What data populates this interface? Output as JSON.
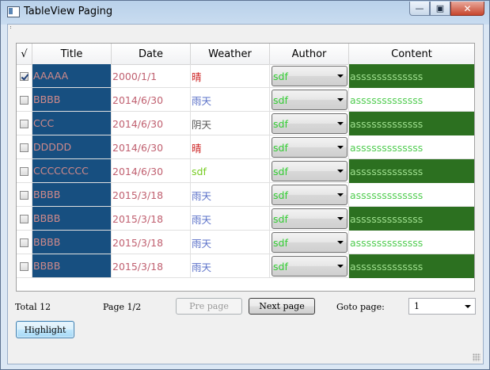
{
  "window": {
    "title": "TableView Paging",
    "minimize_icon": "—",
    "restore_icon": "▣",
    "close_icon": "✕"
  },
  "table": {
    "headers": [
      "√",
      "Title",
      "Date",
      "Weather",
      "Author",
      "Content"
    ],
    "rows": [
      {
        "checked": true,
        "title": "AAAAA",
        "date": "2000/1/1",
        "weather": "晴",
        "weather_color": "red",
        "author": "sdf",
        "content": "asssssssssssss",
        "dark": true
      },
      {
        "checked": false,
        "title": "BBBB",
        "date": "2014/6/30",
        "weather": "雨天",
        "weather_color": "blue",
        "author": "sdf",
        "content": "asssssssssssss",
        "dark": false
      },
      {
        "checked": false,
        "title": "CCC",
        "date": "2014/6/30",
        "weather": "阴天",
        "weather_color": "gray",
        "author": "sdf",
        "content": "asssssssssssss",
        "dark": true
      },
      {
        "checked": false,
        "title": "DDDDD",
        "date": "2014/6/30",
        "weather": "晴",
        "weather_color": "red",
        "author": "sdf",
        "content": "asssssssssssss",
        "dark": false
      },
      {
        "checked": false,
        "title": "CCCCCCCC",
        "date": "2014/6/30",
        "weather": "sdf",
        "weather_color": "green",
        "author": "sdf",
        "content": "asssssssssssss",
        "dark": true
      },
      {
        "checked": false,
        "title": "BBBB",
        "date": "2015/3/18",
        "weather": "雨天",
        "weather_color": "blue",
        "author": "sdf",
        "content": "asssssssssssss",
        "dark": false
      },
      {
        "checked": false,
        "title": "BBBB",
        "date": "2015/3/18",
        "weather": "雨天",
        "weather_color": "blue",
        "author": "sdf",
        "content": "asssssssssssss",
        "dark": true
      },
      {
        "checked": false,
        "title": "BBBB",
        "date": "2015/3/18",
        "weather": "雨天",
        "weather_color": "blue",
        "author": "sdf",
        "content": "asssssssssssss",
        "dark": false
      },
      {
        "checked": false,
        "title": "BBBB",
        "date": "2015/3/18",
        "weather": "雨天",
        "weather_color": "blue",
        "author": "sdf",
        "content": "asssssssssssss",
        "dark": true
      }
    ]
  },
  "pager": {
    "total_label": "Total 12",
    "page_label": "Page 1/2",
    "prev_label": "Pre page",
    "next_label": "Next page",
    "goto_label": "Goto page:",
    "goto_value": "1"
  },
  "highlight_label": "Highlight",
  "colors": {
    "title_bg": "#174f80",
    "content_dark_bg": "#2c7020",
    "author_text": "#33cc33"
  }
}
